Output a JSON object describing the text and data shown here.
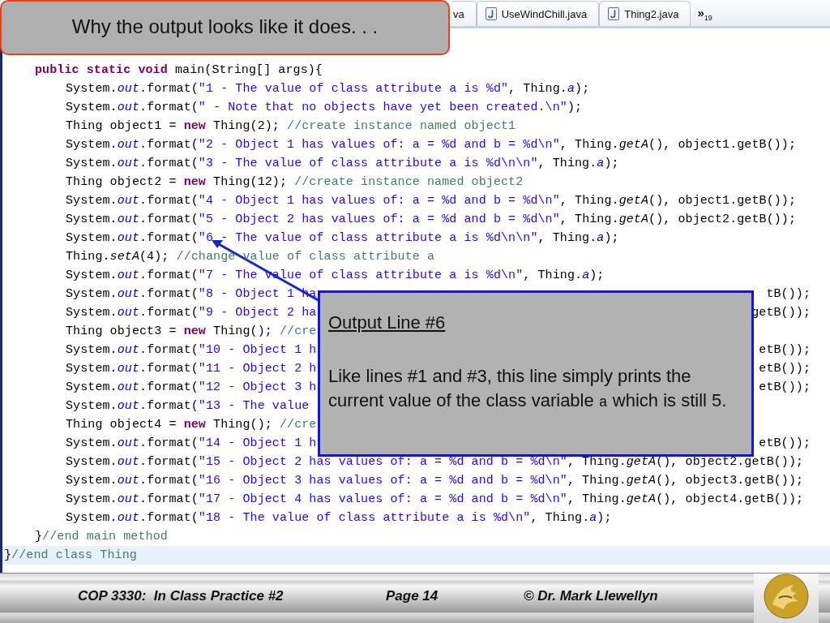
{
  "title_box": {
    "text": "Why the output looks like it does. . ."
  },
  "tabs": [
    {
      "label": "va",
      "selected": false,
      "kind": "cut"
    },
    {
      "label": "UseWindChill.java",
      "selected": false,
      "kind": "file"
    },
    {
      "label": "Thing2.java",
      "selected": false,
      "kind": "file"
    }
  ],
  "more_tabs": {
    "label": "»$_{19}$"
  },
  "code": {
    "lines": [
      {
        "children": [
          {
            "tokens": [
              {
                "kind": "keyword",
                "text": "public static void"
              },
              {
                "kind": "plain",
                "text": " main(String[] args){"
              }
            ],
            "children": [
              {
                "tokens": [
                  {
                    "kind": "plain",
                    "text": "System."
                  },
                  {
                    "kind": "field",
                    "text": "out"
                  },
                  {
                    "kind": "plain",
                    "text": ".format("
                  },
                  {
                    "kind": "string",
                    "text": "\"1 - The value of class attribute a is %d\""
                  },
                  {
                    "kind": "plain",
                    "text": ", Thing."
                  },
                  {
                    "kind": "field",
                    "text": "a"
                  },
                  {
                    "kind": "plain",
                    "text": ");"
                  }
                ]
              },
              {
                "tokens": [
                  {
                    "kind": "plain",
                    "text": "System."
                  },
                  {
                    "kind": "field",
                    "text": "out"
                  },
                  {
                    "kind": "plain",
                    "text": ".format("
                  },
                  {
                    "kind": "string",
                    "text": "\" - Note that no objects have yet been created.\\n\""
                  },
                  {
                    "kind": "plain",
                    "text": ");"
                  }
                ]
              },
              {
                "tokens": [
                  {
                    "kind": "plain",
                    "text": "Thing object1 = "
                  },
                  {
                    "kind": "keyword",
                    "text": "new"
                  },
                  {
                    "kind": "plain",
                    "text": " Thing(2); "
                  },
                  {
                    "kind": "comment",
                    "text": "//create instance named object1"
                  }
                ]
              },
              {
                "tokens": [
                  {
                    "kind": "plain",
                    "text": "System."
                  },
                  {
                    "kind": "field",
                    "text": "out"
                  },
                  {
                    "kind": "plain",
                    "text": ".format("
                  },
                  {
                    "kind": "string",
                    "text": "\"2 - Object 1 has values of: a = %d and b = %d\\n\""
                  },
                  {
                    "kind": "plain",
                    "text": ", Thing."
                  },
                  {
                    "kind": "method",
                    "text": "getA"
                  },
                  {
                    "kind": "plain",
                    "text": "(), object1.getB());"
                  }
                ]
              },
              {
                "tokens": [
                  {
                    "kind": "plain",
                    "text": "System."
                  },
                  {
                    "kind": "field",
                    "text": "out"
                  },
                  {
                    "kind": "plain",
                    "text": ".format("
                  },
                  {
                    "kind": "string",
                    "text": "\"3 - The value of class attribute a is %d\\n\\n\""
                  },
                  {
                    "kind": "plain",
                    "text": ", Thing."
                  },
                  {
                    "kind": "field",
                    "text": "a"
                  },
                  {
                    "kind": "plain",
                    "text": ");"
                  }
                ]
              },
              {
                "tokens": [
                  {
                    "kind": "plain",
                    "text": "Thing object2 = "
                  },
                  {
                    "kind": "keyword",
                    "text": "new"
                  },
                  {
                    "kind": "plain",
                    "text": " Thing(12); "
                  },
                  {
                    "kind": "comment",
                    "text": "//create instance named object2"
                  }
                ]
              },
              {
                "tokens": [
                  {
                    "kind": "plain",
                    "text": "System."
                  },
                  {
                    "kind": "field",
                    "text": "out"
                  },
                  {
                    "kind": "plain",
                    "text": ".format("
                  },
                  {
                    "kind": "string",
                    "text": "\"4 - Object 1 has values of: a = %d and b = %d\\n\""
                  },
                  {
                    "kind": "plain",
                    "text": ", Thing."
                  },
                  {
                    "kind": "method",
                    "text": "getA"
                  },
                  {
                    "kind": "plain",
                    "text": "(), object1.getB());"
                  }
                ]
              },
              {
                "tokens": [
                  {
                    "kind": "plain",
                    "text": "System."
                  },
                  {
                    "kind": "field",
                    "text": "out"
                  },
                  {
                    "kind": "plain",
                    "text": ".format("
                  },
                  {
                    "kind": "string",
                    "text": "\"5 - Object 2 has values of: a = %d and b = %d\\n\""
                  },
                  {
                    "kind": "plain",
                    "text": ", Thing."
                  },
                  {
                    "kind": "method",
                    "text": "getA"
                  },
                  {
                    "kind": "plain",
                    "text": "(), object2.getB());"
                  }
                ]
              },
              {
                "tokens": [
                  {
                    "kind": "plain",
                    "text": "System."
                  },
                  {
                    "kind": "field",
                    "text": "out"
                  },
                  {
                    "kind": "plain",
                    "text": ".format("
                  },
                  {
                    "kind": "string",
                    "text": "\"6 - The value of class attribute a is %d\\n\\n\""
                  },
                  {
                    "kind": "plain",
                    "text": ", Thing."
                  },
                  {
                    "kind": "field",
                    "text": "a"
                  },
                  {
                    "kind": "plain",
                    "text": ");"
                  }
                ]
              },
              {
                "tokens": [
                  {
                    "kind": "plain",
                    "text": "Thing."
                  },
                  {
                    "kind": "method",
                    "text": "setA"
                  },
                  {
                    "kind": "plain",
                    "text": "(4); "
                  },
                  {
                    "kind": "comment",
                    "text": "//change value of class attribute a"
                  }
                ]
              },
              {
                "tokens": [
                  {
                    "kind": "plain",
                    "text": "System."
                  },
                  {
                    "kind": "field",
                    "text": "out"
                  },
                  {
                    "kind": "plain",
                    "text": ".format("
                  },
                  {
                    "kind": "string",
                    "text": "\"7 - The value of class attribute a is %d\\n\""
                  },
                  {
                    "kind": "plain",
                    "text": ", Thing."
                  },
                  {
                    "kind": "field",
                    "text": "a"
                  },
                  {
                    "kind": "plain",
                    "text": ");"
                  }
                ]
              },
              {
                "tokens": [
                  {
                    "kind": "plain",
                    "text": "System."
                  },
                  {
                    "kind": "field",
                    "text": "out"
                  },
                  {
                    "kind": "plain",
                    "text": ".format("
                  },
                  {
                    "kind": "string",
                    "text": "\"8 - Object 1 ha"
                  }
                ],
                "tail": [
                  {
                    "kind": "plain",
                    "text": "tB());"
                  }
                ]
              },
              {
                "tokens": [
                  {
                    "kind": "plain",
                    "text": "System."
                  },
                  {
                    "kind": "field",
                    "text": "out"
                  },
                  {
                    "kind": "plain",
                    "text": ".format("
                  },
                  {
                    "kind": "string",
                    "text": "\"9 - Object 2 ha"
                  }
                ],
                "tail": [
                  {
                    "kind": "plain",
                    "text": "getB());"
                  }
                ]
              },
              {
                "tokens": [
                  {
                    "kind": "plain",
                    "text": "Thing object3 = "
                  },
                  {
                    "kind": "keyword",
                    "text": "new"
                  },
                  {
                    "kind": "plain",
                    "text": " Thing(); "
                  },
                  {
                    "kind": "comment",
                    "text": "//cre"
                  }
                ]
              },
              {
                "tokens": [
                  {
                    "kind": "plain",
                    "text": "System."
                  },
                  {
                    "kind": "field",
                    "text": "out"
                  },
                  {
                    "kind": "plain",
                    "text": ".format("
                  },
                  {
                    "kind": "string",
                    "text": "\"10 - Object 1 h"
                  }
                ],
                "tail": [
                  {
                    "kind": "plain",
                    "text": "etB());"
                  }
                ]
              },
              {
                "tokens": [
                  {
                    "kind": "plain",
                    "text": "System."
                  },
                  {
                    "kind": "field",
                    "text": "out"
                  },
                  {
                    "kind": "plain",
                    "text": ".format("
                  },
                  {
                    "kind": "string",
                    "text": "\"11 - Object 2 h"
                  }
                ],
                "tail": [
                  {
                    "kind": "plain",
                    "text": "etB());"
                  }
                ]
              },
              {
                "tokens": [
                  {
                    "kind": "plain",
                    "text": "System."
                  },
                  {
                    "kind": "field",
                    "text": "out"
                  },
                  {
                    "kind": "plain",
                    "text": ".format("
                  },
                  {
                    "kind": "string",
                    "text": "\"12 - Object 3 h"
                  }
                ],
                "tail": [
                  {
                    "kind": "plain",
                    "text": "etB());"
                  }
                ]
              },
              {
                "tokens": [
                  {
                    "kind": "plain",
                    "text": "System."
                  },
                  {
                    "kind": "field",
                    "text": "out"
                  },
                  {
                    "kind": "plain",
                    "text": ".format("
                  },
                  {
                    "kind": "string",
                    "text": "\"13 - The value"
                  }
                ]
              },
              {
                "tokens": [
                  {
                    "kind": "plain",
                    "text": "Thing object4 = "
                  },
                  {
                    "kind": "keyword",
                    "text": "new"
                  },
                  {
                    "kind": "plain",
                    "text": " Thing(); "
                  },
                  {
                    "kind": "comment",
                    "text": "//cre"
                  }
                ]
              },
              {
                "tokens": [
                  {
                    "kind": "plain",
                    "text": "System."
                  },
                  {
                    "kind": "field",
                    "text": "out"
                  },
                  {
                    "kind": "plain",
                    "text": ".format("
                  },
                  {
                    "kind": "string",
                    "text": "\"14 - Object 1 h"
                  }
                ],
                "tail": [
                  {
                    "kind": "plain",
                    "text": "etB());"
                  }
                ]
              },
              {
                "tokens": [
                  {
                    "kind": "plain",
                    "text": "System."
                  },
                  {
                    "kind": "field",
                    "text": "out"
                  },
                  {
                    "kind": "plain",
                    "text": ".format("
                  },
                  {
                    "kind": "string",
                    "text": "\"15 - Object 2 has values of: a = %d and b = %d\\n\""
                  },
                  {
                    "kind": "plain",
                    "text": ", Thing."
                  },
                  {
                    "kind": "method",
                    "text": "getA"
                  },
                  {
                    "kind": "plain",
                    "text": "(), object2.getB());"
                  }
                ]
              },
              {
                "tokens": [
                  {
                    "kind": "plain",
                    "text": "System."
                  },
                  {
                    "kind": "field",
                    "text": "out"
                  },
                  {
                    "kind": "plain",
                    "text": ".format("
                  },
                  {
                    "kind": "string",
                    "text": "\"16 - Object 3 has values of: a = %d and b = %d\\n\""
                  },
                  {
                    "kind": "plain",
                    "text": ", Thing."
                  },
                  {
                    "kind": "method",
                    "text": "getA"
                  },
                  {
                    "kind": "plain",
                    "text": "(), object3.getB());"
                  }
                ]
              },
              {
                "tokens": [
                  {
                    "kind": "plain",
                    "text": "System."
                  },
                  {
                    "kind": "field",
                    "text": "out"
                  },
                  {
                    "kind": "plain",
                    "text": ".format("
                  },
                  {
                    "kind": "string",
                    "text": "\"17 - Object 4 has values of: a = %d and b = %d\\n\""
                  },
                  {
                    "kind": "plain",
                    "text": ", Thing."
                  },
                  {
                    "kind": "method",
                    "text": "getA"
                  },
                  {
                    "kind": "plain",
                    "text": "(), object4.getB());"
                  }
                ]
              },
              {
                "tokens": [
                  {
                    "kind": "plain",
                    "text": "System."
                  },
                  {
                    "kind": "field",
                    "text": "out"
                  },
                  {
                    "kind": "plain",
                    "text": ".format("
                  },
                  {
                    "kind": "string",
                    "text": "\"18 - The value of class attribute a is %d\\n\""
                  },
                  {
                    "kind": "plain",
                    "text": ", Thing."
                  },
                  {
                    "kind": "field",
                    "text": "a"
                  },
                  {
                    "kind": "plain",
                    "text": ");"
                  }
                ]
              }
            ]
          },
          {
            "tokens": [
              {
                "kind": "plain",
                "text": "}"
              },
              {
                "kind": "comment",
                "text": "//end main method"
              }
            ]
          }
        ]
      },
      {
        "highlighted": true,
        "tokens": [
          {
            "kind": "plain",
            "text": "}"
          },
          {
            "kind": "comment",
            "text": "//end class Thing"
          }
        ]
      }
    ]
  },
  "callout": {
    "title": "Output Line #6",
    "body": [
      {
        "kind": "text",
        "text": "Like lines #1 and #3, this line simply prints the current value of the class variable "
      },
      {
        "kind": "code",
        "text": "a"
      },
      {
        "kind": "text",
        "text": " which is still 5."
      }
    ]
  },
  "footer": {
    "course": "COP 3330:  In Class Practice #2",
    "page": "Page 14",
    "author": "© Dr. Mark Llewellyn"
  }
}
